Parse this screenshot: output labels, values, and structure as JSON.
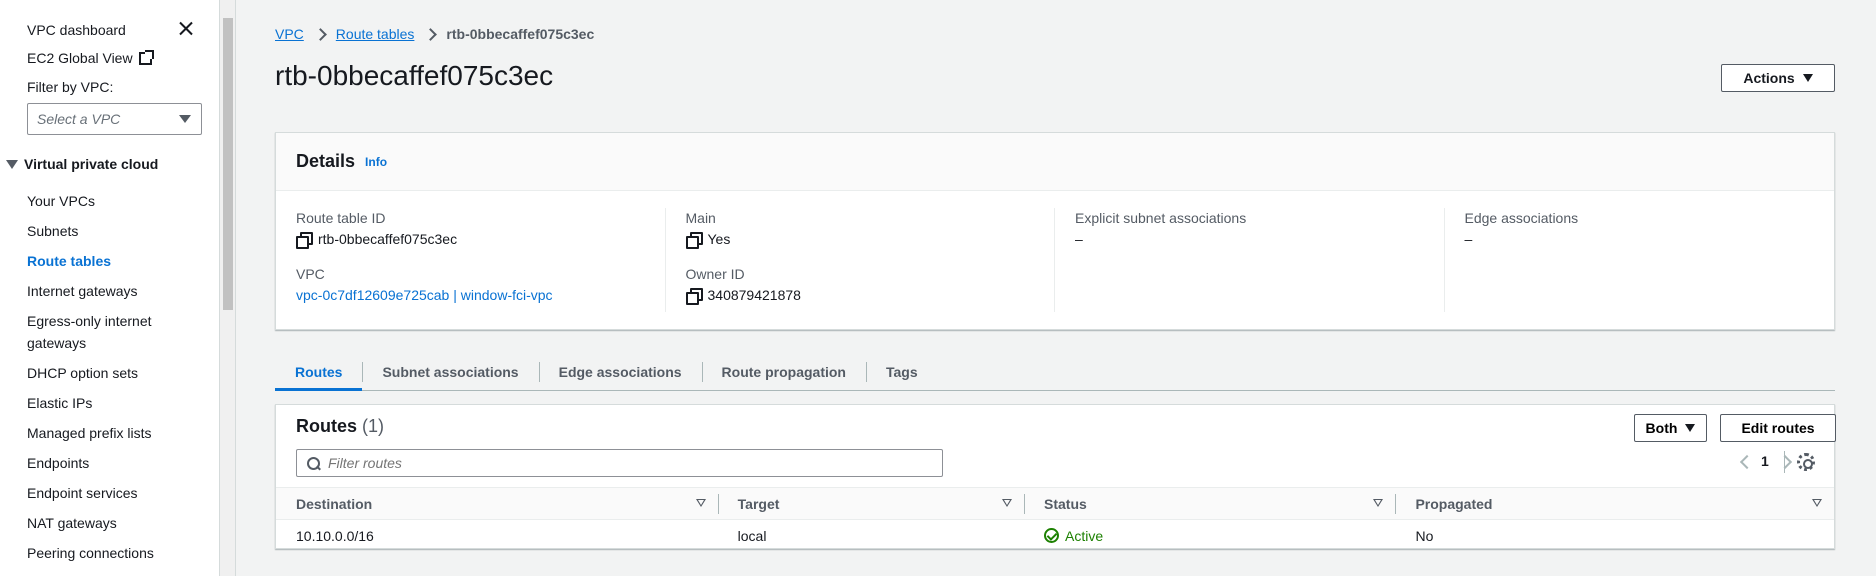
{
  "sidebar": {
    "dashboard": "VPC dashboard",
    "ec2_global_view": "EC2 Global View",
    "filter_label": "Filter by VPC:",
    "filter_placeholder": "Select a VPC",
    "section": "Virtual private cloud",
    "items": [
      {
        "label": "Your VPCs"
      },
      {
        "label": "Subnets"
      },
      {
        "label": "Route tables",
        "active": true
      },
      {
        "label": "Internet gateways"
      },
      {
        "label": "Egress-only internet gateways"
      },
      {
        "label": "DHCP option sets"
      },
      {
        "label": "Elastic IPs"
      },
      {
        "label": "Managed prefix lists"
      },
      {
        "label": "Endpoints"
      },
      {
        "label": "Endpoint services"
      },
      {
        "label": "NAT gateways"
      },
      {
        "label": "Peering connections"
      }
    ]
  },
  "breadcrumb": {
    "vpc": "VPC",
    "route_tables": "Route tables",
    "current": "rtb-0bbecaffef075c3ec"
  },
  "page": {
    "title": "rtb-0bbecaffef075c3ec",
    "actions_label": "Actions"
  },
  "details": {
    "title": "Details",
    "info": "Info",
    "route_table_id_label": "Route table ID",
    "route_table_id": "rtb-0bbecaffef075c3ec",
    "vpc_label": "VPC",
    "vpc_value": "vpc-0c7df12609e725cab | window-fci-vpc",
    "main_label": "Main",
    "main_value": "Yes",
    "owner_label": "Owner ID",
    "owner_value": "340879421878",
    "explicit_label": "Explicit subnet associations",
    "explicit_value": "–",
    "edge_label": "Edge associations",
    "edge_value": "–"
  },
  "tabs": [
    {
      "label": "Routes",
      "active": true
    },
    {
      "label": "Subnet associations"
    },
    {
      "label": "Edge associations"
    },
    {
      "label": "Route propagation"
    },
    {
      "label": "Tags"
    }
  ],
  "routes": {
    "title": "Routes",
    "count": "(1)",
    "both_label": "Both",
    "edit_label": "Edit routes",
    "filter_placeholder": "Filter routes",
    "page": "1",
    "columns": [
      "Destination",
      "Target",
      "Status",
      "Propagated"
    ],
    "rows": [
      {
        "destination": "10.10.0.0/16",
        "target": "local",
        "status": "Active",
        "propagated": "No"
      }
    ]
  },
  "colors": {
    "link": "#0972d3",
    "success": "#1d8102"
  }
}
